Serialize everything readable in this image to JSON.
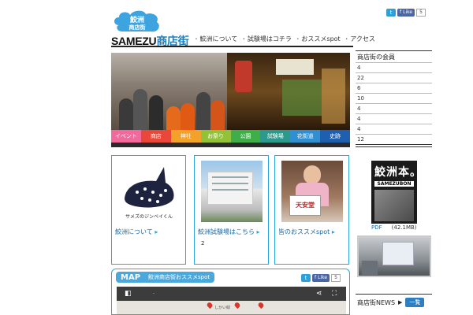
{
  "header": {
    "logo_line1": "鮫洲",
    "logo_line2": "商店街",
    "brand_prefix": "SAMEZU",
    "brand_suffix": "商店街",
    "nav": [
      "鮫洲について",
      "試験場はコチラ",
      "おススメspot",
      "アクセス"
    ],
    "social": {
      "twitter": "t",
      "facebook": "Like",
      "count": "5"
    }
  },
  "hero": {
    "categories": [
      {
        "label": "イベント",
        "color": "#f26a9c"
      },
      {
        "label": "商店",
        "color": "#e8473a"
      },
      {
        "label": "神社",
        "color": "#f2a12b"
      },
      {
        "label": "お祭り",
        "color": "#93c23a"
      },
      {
        "label": "公園",
        "color": "#3fae49"
      },
      {
        "label": "試験場",
        "color": "#2b9a8c"
      },
      {
        "label": "花街道",
        "color": "#2f8fd1"
      },
      {
        "label": "史跡",
        "color": "#1f5fb0"
      }
    ]
  },
  "cards": [
    {
      "link": "鮫洲について",
      "illustration_text": "サメズのジンベイくん",
      "num": ""
    },
    {
      "link": "鮫洲試験場はこちら",
      "num": "2"
    },
    {
      "link": "皆のおススメspot",
      "sign_text": "天安堂",
      "num": ""
    }
  ],
  "map": {
    "title": "MAP",
    "subtitle": "鮫洲商店街おススメspot",
    "social": {
      "twitter": "t",
      "facebook": "Like",
      "count": "5"
    },
    "road_label": "しかい緑"
  },
  "sidebar": {
    "members_heading": "商店街の会員",
    "members": [
      "4",
      "22",
      "6",
      "10",
      "4",
      "4",
      "4",
      "12"
    ],
    "book_title": "鮫洲本。",
    "book_sub": "SAMEZUBON",
    "pdf_label": "PDF",
    "pdf_size": "(42.1MB)",
    "news_heading": "商店街NEWS",
    "news_button": "一覧"
  }
}
